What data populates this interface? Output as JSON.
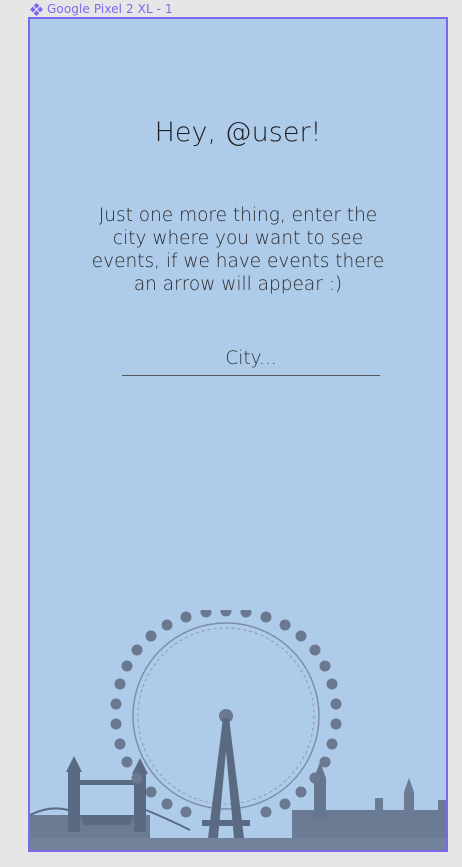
{
  "frame": {
    "label": "Google Pixel 2 XL - 1",
    "accent_color": "#7b68ee",
    "background_color": "#afcbea"
  },
  "screen": {
    "greeting": "Hey, @user!",
    "instructions": "Just one more thing, enter the city where you want to see events, if we have events there an arrow will appear :)",
    "city_input": {
      "placeholder": "City...",
      "value": ""
    },
    "illustration": "london-skyline-illustration"
  }
}
